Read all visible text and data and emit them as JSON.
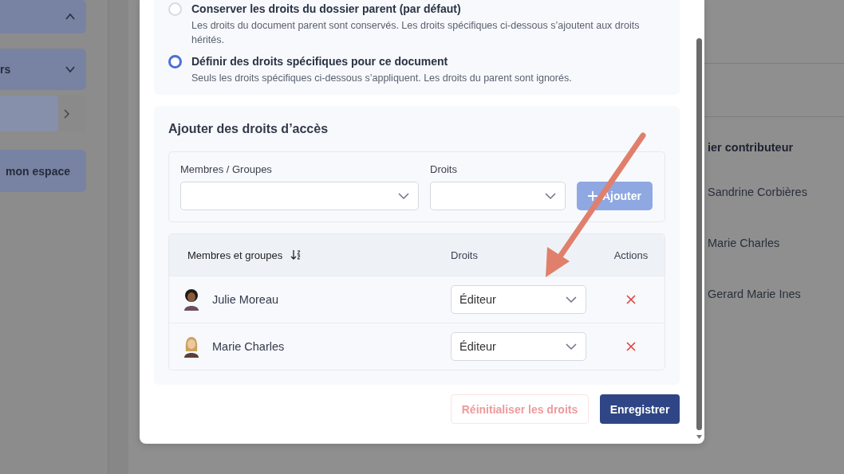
{
  "sidebar": {
    "items": [
      {
        "kind": "expandable",
        "expanded": true
      },
      {
        "kind": "expandable",
        "label": "rs",
        "expanded": false
      },
      {
        "kind": "link"
      },
      {
        "kind": "button",
        "label": "mon espace"
      }
    ]
  },
  "background": {
    "column_heading": "ier contributeur",
    "contributors": [
      "Sandrine Corbières",
      "Marie Charles",
      "Gerard Marie Ines"
    ]
  },
  "modal": {
    "inheritance_options": [
      {
        "label": "Conserver les droits du dossier parent (par défaut)",
        "description": "Les droits du document parent sont conservés. Les droits spécifiques ci-dessous s’ajoutent aux droits hérités.",
        "selected": false
      },
      {
        "label": "Définir des droits spécifiques pour ce document",
        "description": "Seuls les droits spécifiques ci-dessous s’appliquent. Les droits du parent sont ignorés.",
        "selected": true
      }
    ],
    "add_section": {
      "title": "Ajouter des droits d’accès",
      "members_label": "Membres / Groupes",
      "rights_label": "Droits",
      "add_button": "Ajouter",
      "add_disabled": true
    },
    "table": {
      "columns": [
        "Membres et groupes",
        "Droits",
        "Actions"
      ],
      "rows": [
        {
          "name": "Julie Moreau",
          "rights": "Éditeur",
          "kind": "curly"
        },
        {
          "name": "Marie Charles",
          "rights": "Éditeur",
          "kind": "long"
        }
      ]
    },
    "buttons": [
      {
        "label": "Réinitialiser les droits",
        "kind": "secondary"
      },
      {
        "label": "Enregistrer",
        "kind": "primary"
      }
    ]
  }
}
